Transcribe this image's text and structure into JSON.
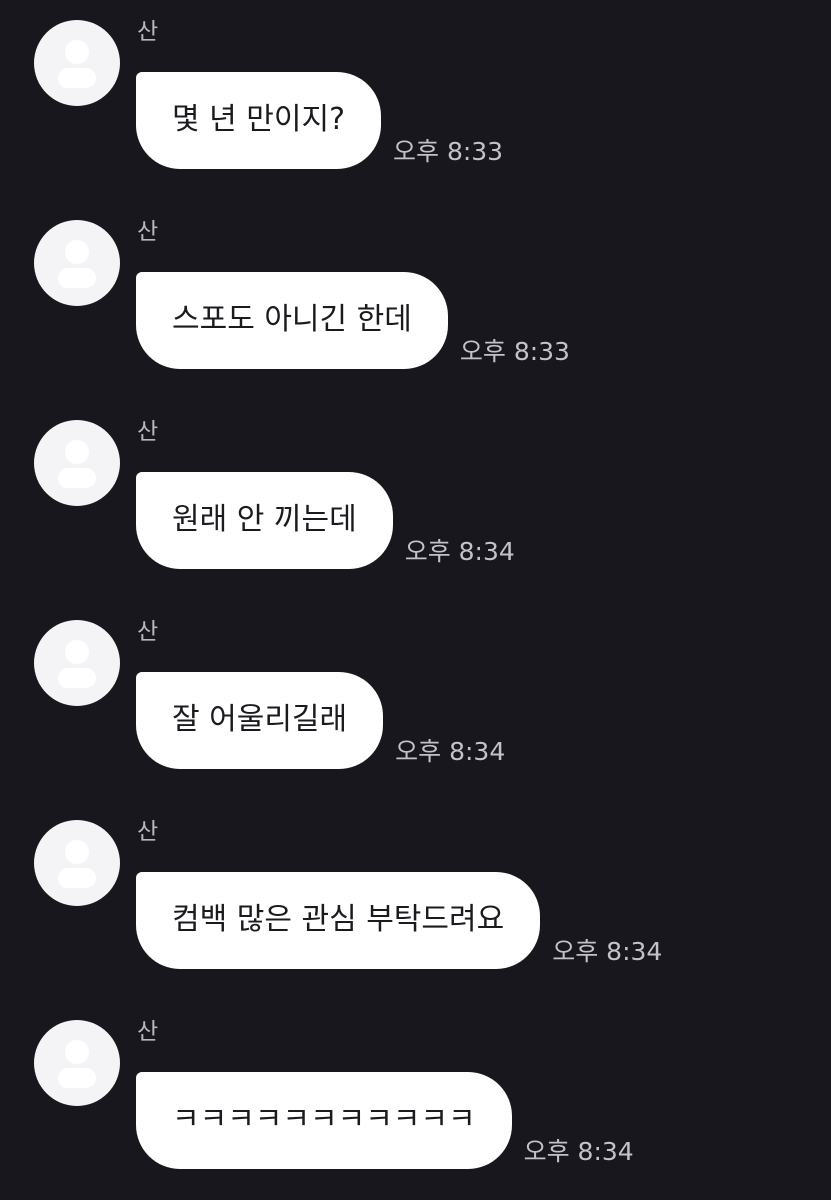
{
  "messages": [
    {
      "sender": "산",
      "text": "몇 년 만이지?",
      "time": "오후 8:33"
    },
    {
      "sender": "산",
      "text": "스포도 아니긴 한데",
      "time": "오후 8:33"
    },
    {
      "sender": "산",
      "text": "원래 안 끼는데",
      "time": "오후 8:34"
    },
    {
      "sender": "산",
      "text": "잘 어울리길래",
      "time": "오후 8:34"
    },
    {
      "sender": "산",
      "text": "컴백 많은 관심 부탁드려요",
      "time": "오후 8:34"
    },
    {
      "sender": "산",
      "text": "ㅋㅋㅋㅋㅋㅋㅋㅋㅋㅋㅋ",
      "time": "오후 8:34"
    }
  ],
  "colors": {
    "background": "#17171d",
    "bubble": "#ffffff",
    "avatar": "#f4f4f6"
  }
}
